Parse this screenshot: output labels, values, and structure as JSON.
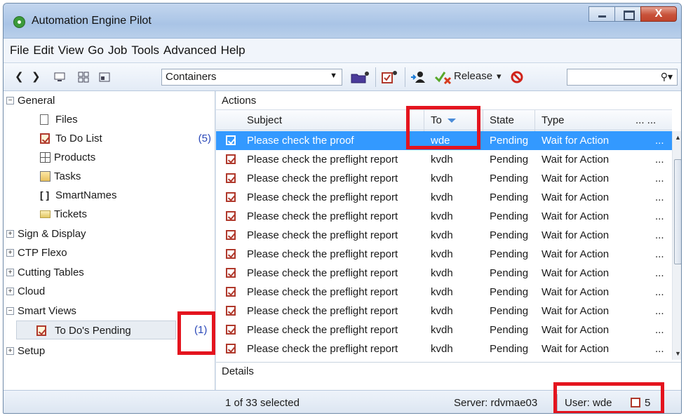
{
  "window": {
    "title": "Automation Engine Pilot",
    "close_glyph": "X"
  },
  "menu": [
    "File",
    "Edit",
    "View",
    "Go",
    "Job",
    "Tools",
    "Advanced",
    "Help"
  ],
  "toolbar": {
    "back": "❮",
    "forward": "❯",
    "view_combo": "Containers",
    "release_label": "Release",
    "release_dropdown": "▾",
    "search_placeholder": "",
    "search_icon": "search-icon"
  },
  "tree": {
    "general": {
      "label": "General",
      "expander": "−"
    },
    "files": "Files",
    "todo_list": {
      "label": "To Do List",
      "count": "(5)"
    },
    "products": "Products",
    "tasks": "Tasks",
    "smartnames": "SmartNames",
    "tickets": "Tickets",
    "sign_display": "Sign & Display",
    "ctp_flexo": "CTP Flexo",
    "cutting_tables": "Cutting Tables",
    "cloud": "Cloud",
    "smart_views": "Smart Views",
    "todos_pending": {
      "label": "To Do's Pending",
      "count": "(1)"
    },
    "setup": "Setup",
    "plus": "+",
    "minus": "−"
  },
  "actions": {
    "label": "Actions",
    "columns": {
      "subject": "Subject",
      "to": "To",
      "state": "State",
      "type": "Type",
      "more": "... ..."
    },
    "rows": [
      {
        "subject": "Please check the proof",
        "to": "wde",
        "state": "Pending",
        "type": "Wait for Action",
        "more": "..."
      },
      {
        "subject": "Please check the preflight report",
        "to": "kvdh",
        "state": "Pending",
        "type": "Wait for Action",
        "more": "..."
      },
      {
        "subject": "Please check the preflight report",
        "to": "kvdh",
        "state": "Pending",
        "type": "Wait for Action",
        "more": "..."
      },
      {
        "subject": "Please check the preflight report",
        "to": "kvdh",
        "state": "Pending",
        "type": "Wait for Action",
        "more": "..."
      },
      {
        "subject": "Please check the preflight report",
        "to": "kvdh",
        "state": "Pending",
        "type": "Wait for Action",
        "more": "..."
      },
      {
        "subject": "Please check the preflight report",
        "to": "kvdh",
        "state": "Pending",
        "type": "Wait for Action",
        "more": "..."
      },
      {
        "subject": "Please check the preflight report",
        "to": "kvdh",
        "state": "Pending",
        "type": "Wait for Action",
        "more": "..."
      },
      {
        "subject": "Please check the preflight report",
        "to": "kvdh",
        "state": "Pending",
        "type": "Wait for Action",
        "more": "..."
      },
      {
        "subject": "Please check the preflight report",
        "to": "kvdh",
        "state": "Pending",
        "type": "Wait for Action",
        "more": "..."
      },
      {
        "subject": "Please check the preflight report",
        "to": "kvdh",
        "state": "Pending",
        "type": "Wait for Action",
        "more": "..."
      },
      {
        "subject": "Please check the preflight report",
        "to": "kvdh",
        "state": "Pending",
        "type": "Wait for Action",
        "more": "..."
      },
      {
        "subject": "Please check the preflight report",
        "to": "kvdh",
        "state": "Pending",
        "type": "Wait for Action",
        "more": "..."
      }
    ]
  },
  "details": {
    "label": "Details"
  },
  "status": {
    "selection": "1 of 33 selected",
    "server": "Server: rdvmae03",
    "user": "User: wde",
    "todo_count": "5"
  },
  "colors": {
    "selection": "#3399ff",
    "highlight": "#e4141e",
    "count_text": "#2947b8"
  }
}
